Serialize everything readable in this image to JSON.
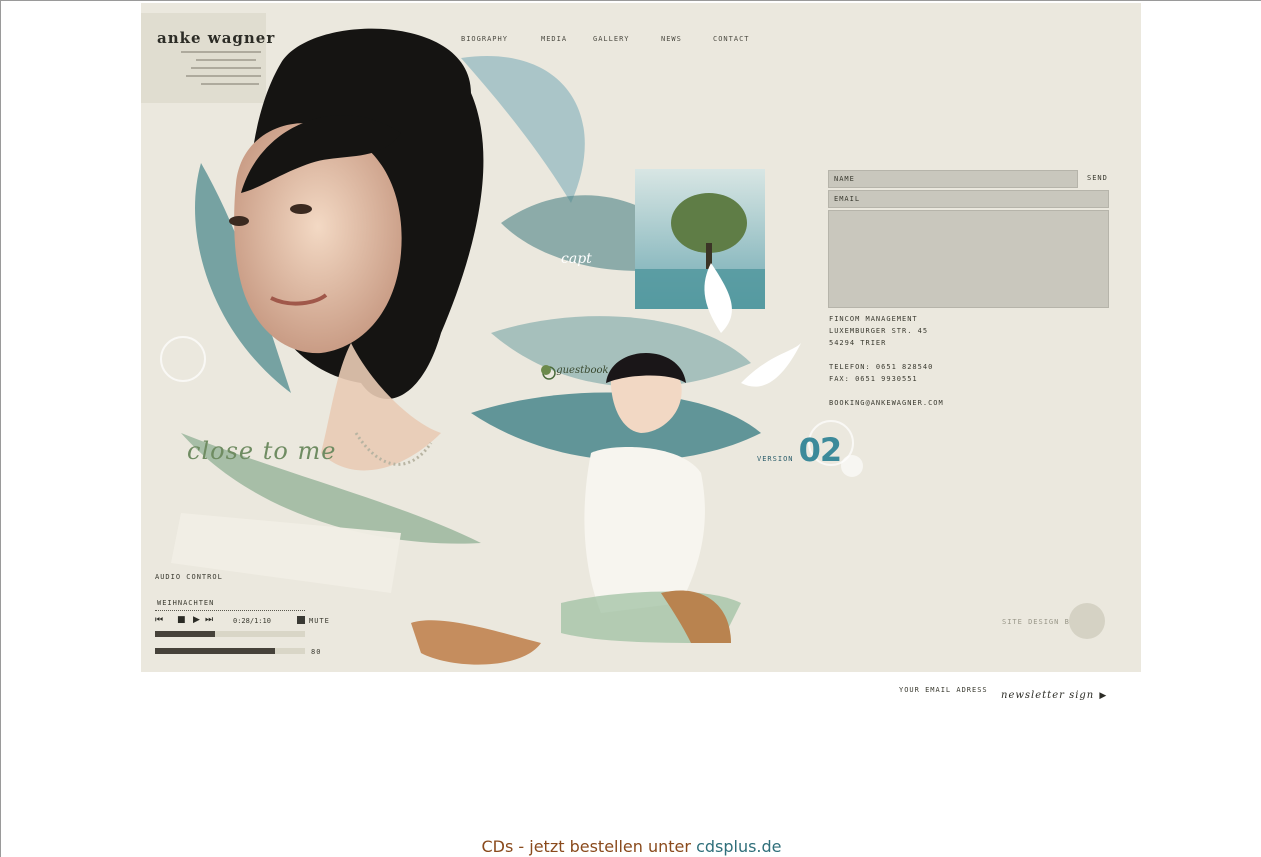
{
  "site": {
    "logo": "anke wagner",
    "nav": [
      "BIOGRAPHY",
      "MEDIA",
      "GALLERY",
      "NEWS",
      "CONTACT"
    ]
  },
  "contact_form": {
    "name_placeholder": "NAME",
    "email_placeholder": "EMAIL",
    "send_label": "SEND"
  },
  "address": {
    "line1": "FINCOM MANAGEMENT",
    "line2": "LUXEMBURGER STR. 45",
    "line3": "54294 TRIER",
    "phone": "TELEFON: 0651 828540",
    "fax": "FAX: 0651 9930551",
    "email": "BOOKING@ANKEWAGNER.COM"
  },
  "artwork": {
    "title_script": "close to me",
    "guestbook": "guestbook",
    "version_label": "VERSION",
    "version_number": "02",
    "capt": "capt"
  },
  "audio": {
    "section_label": "AUDIO CONTROL",
    "track_name": "WEIHNACHTEN",
    "time": "0:28/1:10",
    "mute_label": "MUTE",
    "volume_value": "80",
    "progress_fraction": 0.4,
    "volume_fraction": 0.8
  },
  "credit": {
    "label": "SITE DESIGN BY"
  },
  "newsletter": {
    "placeholder": "YOUR EMAIL ADRESS",
    "label": "newsletter sign"
  },
  "footer": {
    "text": "CDs - jetzt bestellen unter ",
    "link": "cdsplus.de",
    "text_color": "#8a4a1c",
    "link_color": "#2f6f7a"
  },
  "colors": {
    "stage_bg": "#ebe8de",
    "teal_accent": "#3c8a9a",
    "field_bg": "#c9c7bd"
  }
}
